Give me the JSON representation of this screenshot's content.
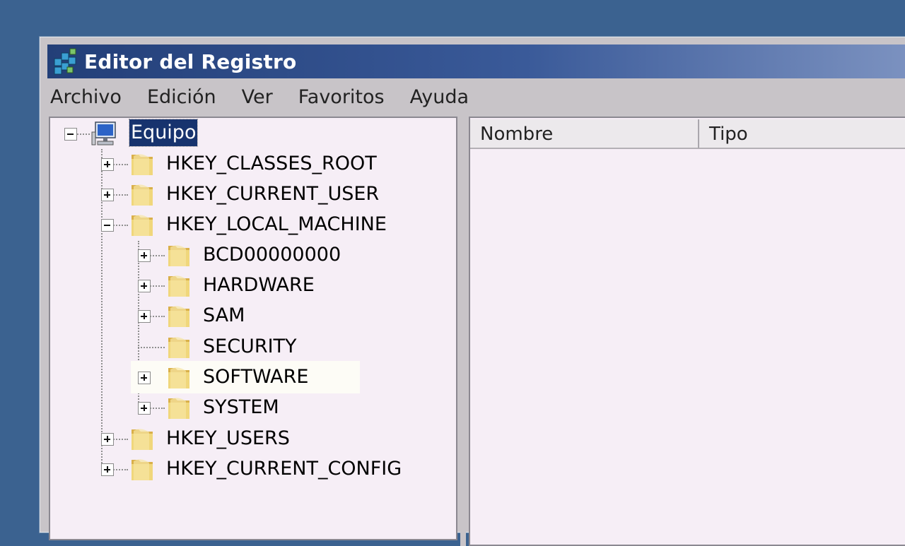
{
  "window": {
    "title": "Editor del Registro",
    "icon": "regedit-icon"
  },
  "menu": [
    "Archivo",
    "Edición",
    "Ver",
    "Favoritos",
    "Ayuda"
  ],
  "tree": {
    "root": "Equipo",
    "hives": [
      "HKEY_CLASSES_ROOT",
      "HKEY_CURRENT_USER",
      "HKEY_LOCAL_MACHINE",
      "HKEY_USERS",
      "HKEY_CURRENT_CONFIG"
    ],
    "local_machine_keys": [
      "BCD00000000",
      "HARDWARE",
      "SAM",
      "SECURITY",
      "SOFTWARE",
      "SYSTEM"
    ]
  },
  "list": {
    "columns": [
      "Nombre",
      "Tipo"
    ]
  },
  "colors": {
    "desktop": "#3b6290",
    "titlebar": "#233f78",
    "selection": "#17336e",
    "pane": "#f6eef6"
  }
}
